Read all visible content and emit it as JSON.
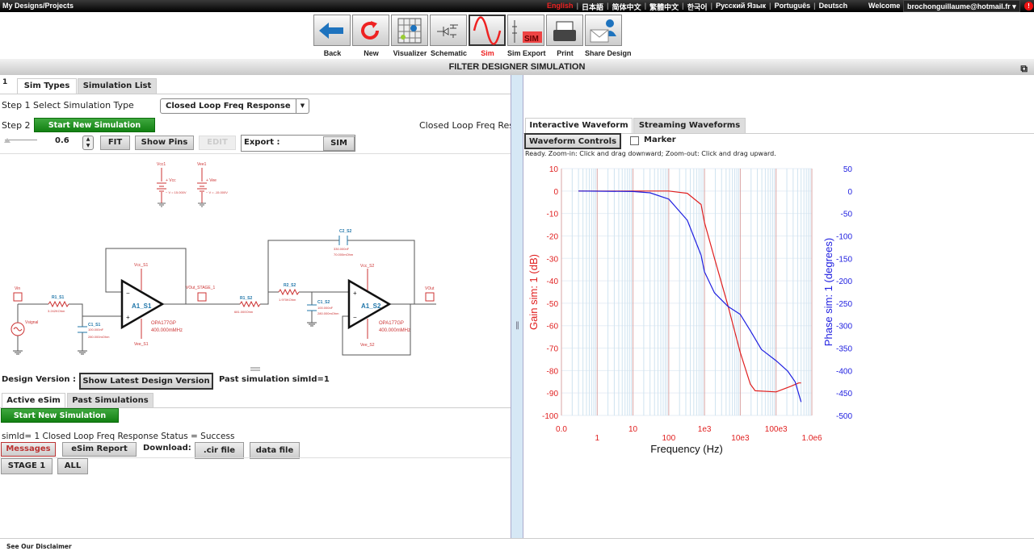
{
  "topbar": {
    "brand": "My Designs/Projects",
    "languages": [
      "English",
      "日本語",
      "简体中文",
      "繁體中文",
      "한국어",
      "Русский Язык",
      "Português",
      "Deutsch"
    ],
    "welcome": "Welcome",
    "user": "brochonguillaume@hotmail.fr",
    "user_caret": "▾",
    "alert": "!"
  },
  "toolbar": [
    {
      "label": "Back",
      "icon": "back-arrow-icon"
    },
    {
      "label": "New",
      "icon": "refresh-icon"
    },
    {
      "label": "Visualizer",
      "icon": "visualizer-icon"
    },
    {
      "label": "Schematic",
      "icon": "schematic-icon"
    },
    {
      "label": "Sim",
      "icon": "sine-wave-icon"
    },
    {
      "label": "Sim Export",
      "icon": "sim-export-icon",
      "badge": "SIM"
    },
    {
      "label": "Print",
      "icon": "printer-icon"
    },
    {
      "label": "Share Design",
      "icon": "share-envelope-icon"
    }
  ],
  "title": "FILTER DESIGNER SIMULATION",
  "left": {
    "tab_number": "1",
    "tabs": [
      "Sim Types",
      "Simulation List"
    ],
    "step1_label": "Step 1 Select Simulation Type",
    "sim_type": "Closed Loop Freq Response",
    "step2_label": "Step 2",
    "start_sim": "Start New Simulation",
    "sim_title": "Closed Loop Freq Res",
    "zoom_value": "0.6",
    "fit": "FIT",
    "show_pins": "Show Pins",
    "edit": "EDIT",
    "export_label": "Export :",
    "sim_btn": "SIM",
    "design_version_label": "Design Version :",
    "show_latest": "Show Latest Design Version",
    "past_sim": "Past simulation simId=1",
    "esim_tabs": [
      "Active eSim",
      "Past Simulations"
    ],
    "start_sim2": "Start New Simulation",
    "status": "simId= 1 Closed Loop Freq Response Status = Success",
    "messages": "Messages",
    "esim_report": "eSim Report",
    "download_label": "Download:",
    "cir_file": ".cir file",
    "data_file": "data file",
    "stage1": "STAGE 1",
    "all": "ALL"
  },
  "schematic": {
    "vcc1": "Vcc1",
    "vcc_plus": "+ Vcc",
    "vcc_v": "− V = 15.000V",
    "vee1": "Vee1",
    "vee_plus": "+ Vee",
    "vee_v": "− V = -15.000V",
    "vin": "Vin",
    "vsignal": "Vsignal",
    "r1_s1": "R1_S1",
    "r1_s1_val": "3.242KOhm",
    "c1_s1": "C1_S1",
    "c1_s1_val1": "100.000nF",
    "c1_s1_val2": "280.000mOhm",
    "a1_s1": "A1_S1",
    "vcc_s1": "Vcc_S1",
    "vee_s1": "Vee_S1",
    "opa1": "OPA177GP",
    "opa1_bw": "400.000mMHz",
    "vout_stage1": "VOut_STAGE_1",
    "r1_s2": "R1_S2",
    "r1_s2_val": "681.000Ohm",
    "r2_s2": "R2_S2",
    "r2_s2_val": "1.970KOhm",
    "c2_s2": "C2_S2",
    "c2_s2_val1": "330.000nF",
    "c2_s2_val2": "70.000mOhm",
    "c1_s2": "C1_S2",
    "c1_s2_val1": "100.000nF",
    "c1_s2_val2": "280.000mOhm",
    "a1_s2": "A1_S2",
    "vcc_s2": "Vcc_S2",
    "vee_s2": "Vee_S2",
    "opa2": "OPA177GP",
    "opa2_bw": "400.000mMHz",
    "vout": "VOut"
  },
  "right": {
    "tabs": [
      "Interactive Waveform",
      "Streaming Waveforms"
    ],
    "waveform_controls": "Waveform Controls",
    "marker": "Marker",
    "hint": "Ready.  Zoom-in: Click and drag downward; Zoom-out: Click and drag upward."
  },
  "chart_data": {
    "type": "line",
    "xscale": "log",
    "xlim": [
      0.1,
      1000000
    ],
    "xticks": [
      {
        "v": 0.1,
        "label": "0.0"
      },
      {
        "v": 1,
        "label": "1"
      },
      {
        "v": 10,
        "label": "10"
      },
      {
        "v": 100,
        "label": "100"
      },
      {
        "v": 1000,
        "label": "1e3"
      },
      {
        "v": 10000,
        "label": "10e3"
      },
      {
        "v": 100000,
        "label": "100e3"
      },
      {
        "v": 1000000,
        "label": "1.0e6"
      }
    ],
    "xlabel": "Frequency (Hz)",
    "ylabel_left": "Gain sim:  1 (dB)",
    "ylim_left": [
      -100,
      10
    ],
    "yticks_left": [
      10,
      0,
      -10,
      -20,
      -30,
      -40,
      -50,
      -60,
      -70,
      -80,
      -90,
      -100
    ],
    "ylabel_right": "Phase sim:  1 (degrees)",
    "ylim_right": [
      -500,
      50
    ],
    "yticks_right": [
      50,
      0,
      -50,
      -100,
      -150,
      -200,
      -250,
      -300,
      -350,
      -400,
      -450,
      -500
    ],
    "colors": {
      "gain": "#e02020",
      "phase": "#2020e0"
    },
    "series": [
      {
        "name": "Gain",
        "axis": "left",
        "x": [
          0.3,
          10,
          100,
          330,
          800,
          1000,
          1900,
          4500,
          10000,
          19000,
          26000,
          100000,
          260000,
          430000,
          500000
        ],
        "y": [
          0,
          0,
          0,
          -1,
          -6,
          -14,
          -30,
          -51,
          -72,
          -86,
          -89,
          -89.5,
          -87,
          -85.5,
          -85.5
        ]
      },
      {
        "name": "Phase",
        "axis": "right",
        "x": [
          0.3,
          10,
          30,
          100,
          330,
          800,
          1000,
          1900,
          4500,
          10000,
          19000,
          39000,
          100000,
          210000,
          340000,
          500000
        ],
        "y": [
          0,
          -1,
          -4,
          -18,
          -65,
          -143,
          -180,
          -227,
          -257,
          -275,
          -311,
          -353,
          -378,
          -401,
          -425,
          -470
        ]
      }
    ]
  },
  "footer": "See Our Disclaimer"
}
